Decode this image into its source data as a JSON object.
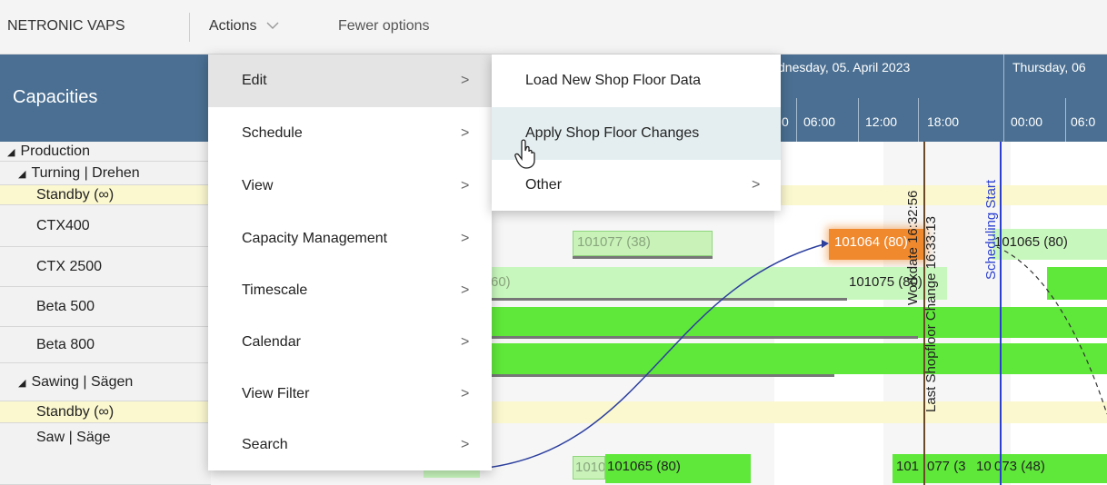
{
  "topbar": {
    "app_name": "NETRONIC VAPS",
    "actions_label": "Actions",
    "fewer_options_label": "Fewer options"
  },
  "capacities_title": "Capacities",
  "timescale": {
    "days": [
      "dnesday, 05. April 2023",
      "Thursday, 06"
    ],
    "hours": [
      "0",
      "06:00",
      "12:00",
      "18:00",
      "00:00",
      "06:0"
    ]
  },
  "rows": [
    {
      "label": "Production",
      "level": 0,
      "expandable": true
    },
    {
      "label": "Turning | Drehen",
      "level": 1,
      "expandable": true
    },
    {
      "label": "Standby (∞)",
      "level": 2,
      "standby": true
    },
    {
      "label": "CTX400",
      "level": 2
    },
    {
      "label": "CTX 2500",
      "level": 2
    },
    {
      "label": "Beta 500",
      "level": 2
    },
    {
      "label": "Beta 800",
      "level": 2
    },
    {
      "label": "Sawing | Sägen",
      "level": 1,
      "expandable": true
    },
    {
      "label": "Standby (∞)",
      "level": 2,
      "standby": true
    },
    {
      "label": "Saw | Säge",
      "level": 2
    }
  ],
  "gantt": {
    "bars": [
      "101077 (38)",
      "101064 (80)",
      "101065 (80)",
      "60)",
      "10107",
      "5 (80)",
      "1010",
      "101065 (80)",
      "101",
      "077 (3",
      "10",
      "073 (48)"
    ],
    "markers": [
      "Last Shopfloor Change 16:33:13",
      "Workdate 16:32:56",
      "Scheduling Start"
    ],
    "colors": {
      "marker_last": "#6b4a2a",
      "marker_sched": "#2b3fd1",
      "order_highlight": "#f0892e"
    }
  },
  "menu_main": {
    "items": [
      {
        "label": "Edit"
      },
      {
        "label": "Schedule"
      },
      {
        "label": "View"
      },
      {
        "label": "Capacity Management"
      },
      {
        "label": "Timescale"
      },
      {
        "label": "Calendar"
      },
      {
        "label": "View Filter"
      },
      {
        "label": "Search"
      }
    ],
    "active": "Edit"
  },
  "menu_edit": {
    "items": [
      {
        "label": "Load New Shop Floor Data"
      },
      {
        "label": "Apply Shop Floor Changes"
      },
      {
        "label": "Other"
      }
    ],
    "hovered": "Apply Shop Floor Changes"
  },
  "chevron": ">"
}
